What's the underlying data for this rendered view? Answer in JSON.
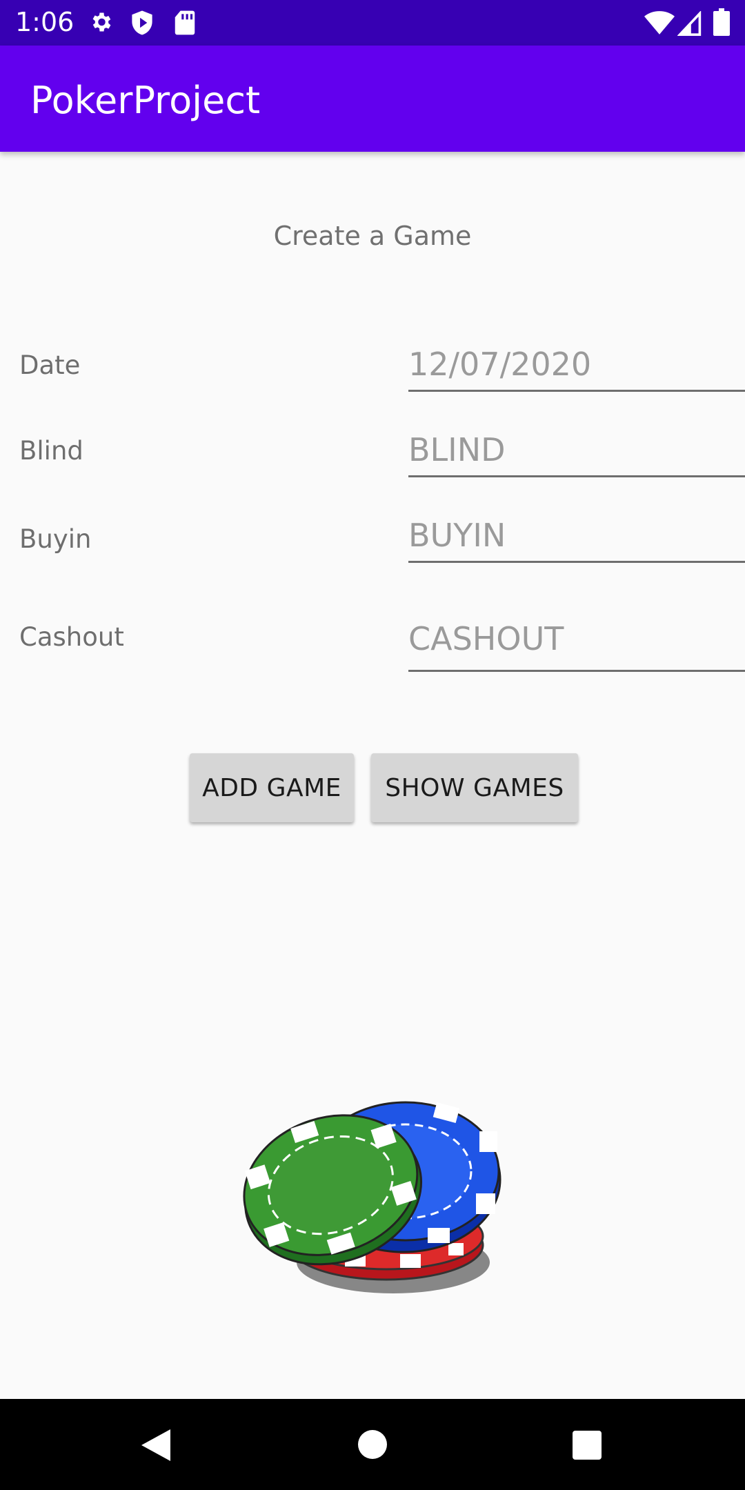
{
  "status_bar": {
    "time": "1:06",
    "icons_left": [
      "gear-icon",
      "shield-icon",
      "sd-card-icon"
    ],
    "icons_right": [
      "wifi-icon",
      "signal-icon",
      "battery-icon"
    ]
  },
  "app_bar": {
    "title": "PokerProject"
  },
  "form": {
    "heading": "Create a Game",
    "date_label": "Date",
    "date_value": "12/07/2020",
    "blind_label": "Blind",
    "blind_placeholder": "BLIND",
    "buyin_label": "Buyin",
    "buyin_placeholder": "BUYIN",
    "cashout_label": "Cashout",
    "cashout_placeholder": "CASHOUT"
  },
  "buttons": {
    "add_game": "ADD GAME",
    "show_games": "SHOW GAMES"
  },
  "image": {
    "icon": "poker-chips-icon"
  },
  "nav_bar": {
    "icons": [
      "back-icon",
      "home-icon",
      "recents-icon"
    ]
  },
  "colors": {
    "status_bar": "#3700b3",
    "app_bar": "#6200ee",
    "button": "#d6d6d6",
    "background": "#fafafa"
  }
}
